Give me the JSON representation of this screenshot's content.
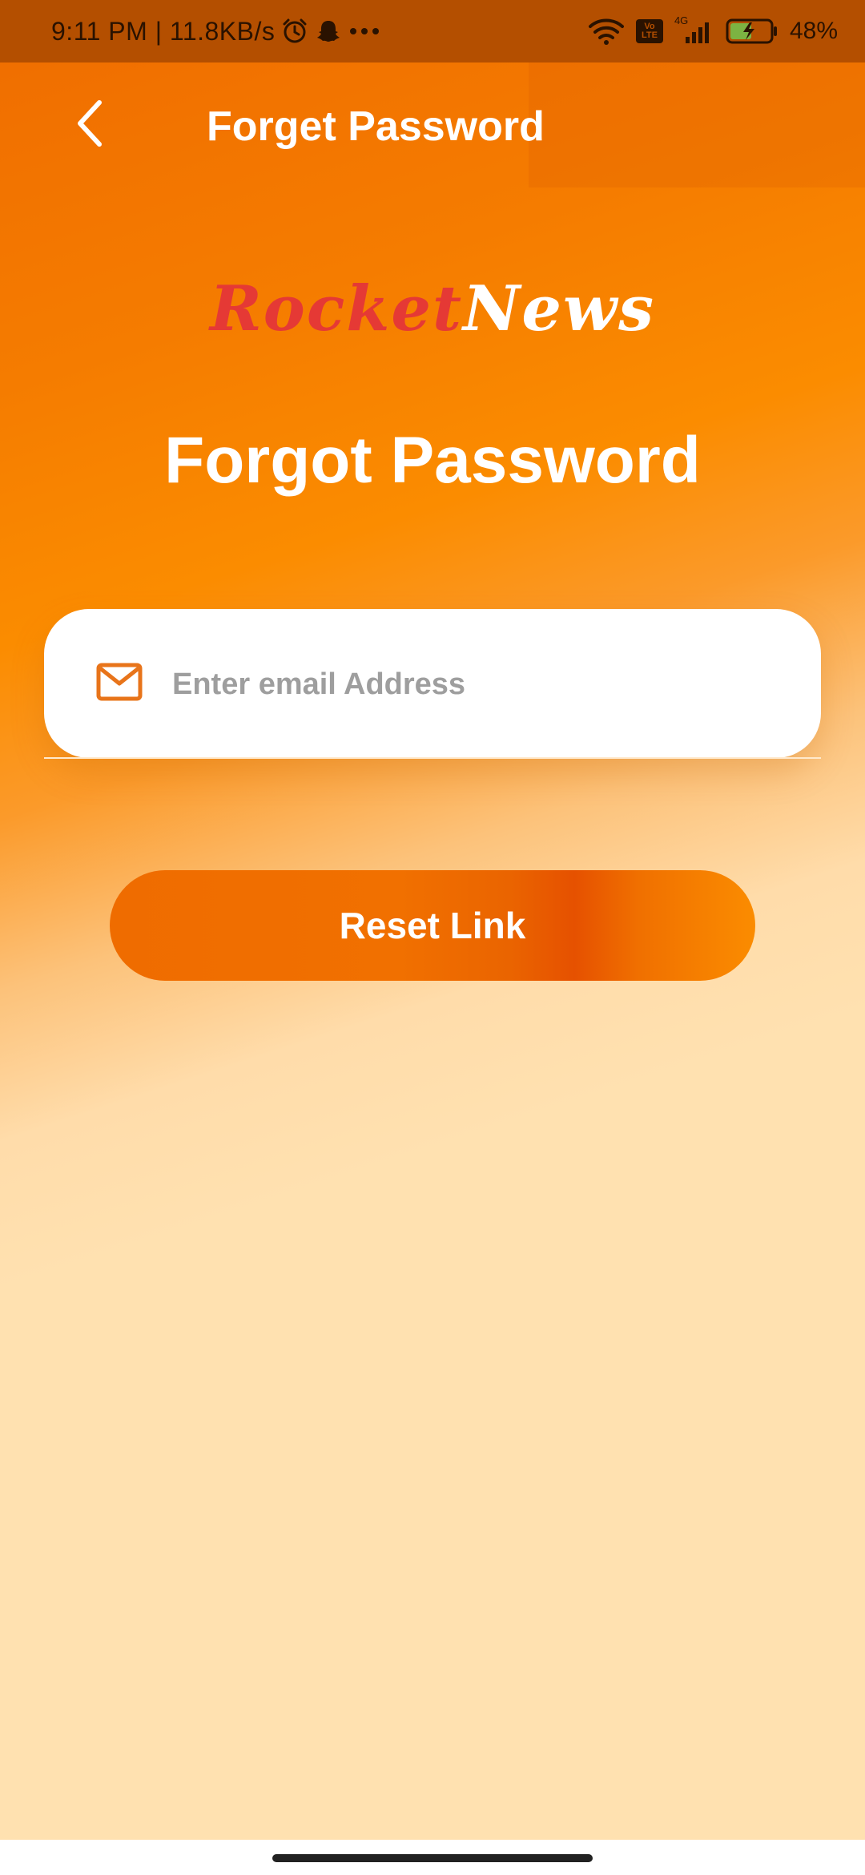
{
  "status_bar": {
    "time_speed": "9:11 PM | 11.8KB/s",
    "volte_top": "Vo",
    "volte_bottom": "LTE",
    "network_type": "4G",
    "battery_percent": "48%"
  },
  "app_bar": {
    "title": "Forget Password"
  },
  "logo": {
    "part1": "Rocket",
    "part2": "News"
  },
  "heading": "Forgot Password",
  "email_field": {
    "placeholder": "Enter email Address",
    "value": ""
  },
  "reset_button": {
    "label": "Reset Link"
  },
  "colors": {
    "accent": "#ef6c00",
    "logo_red": "#e53935",
    "background_light": "#ffe1b0"
  }
}
